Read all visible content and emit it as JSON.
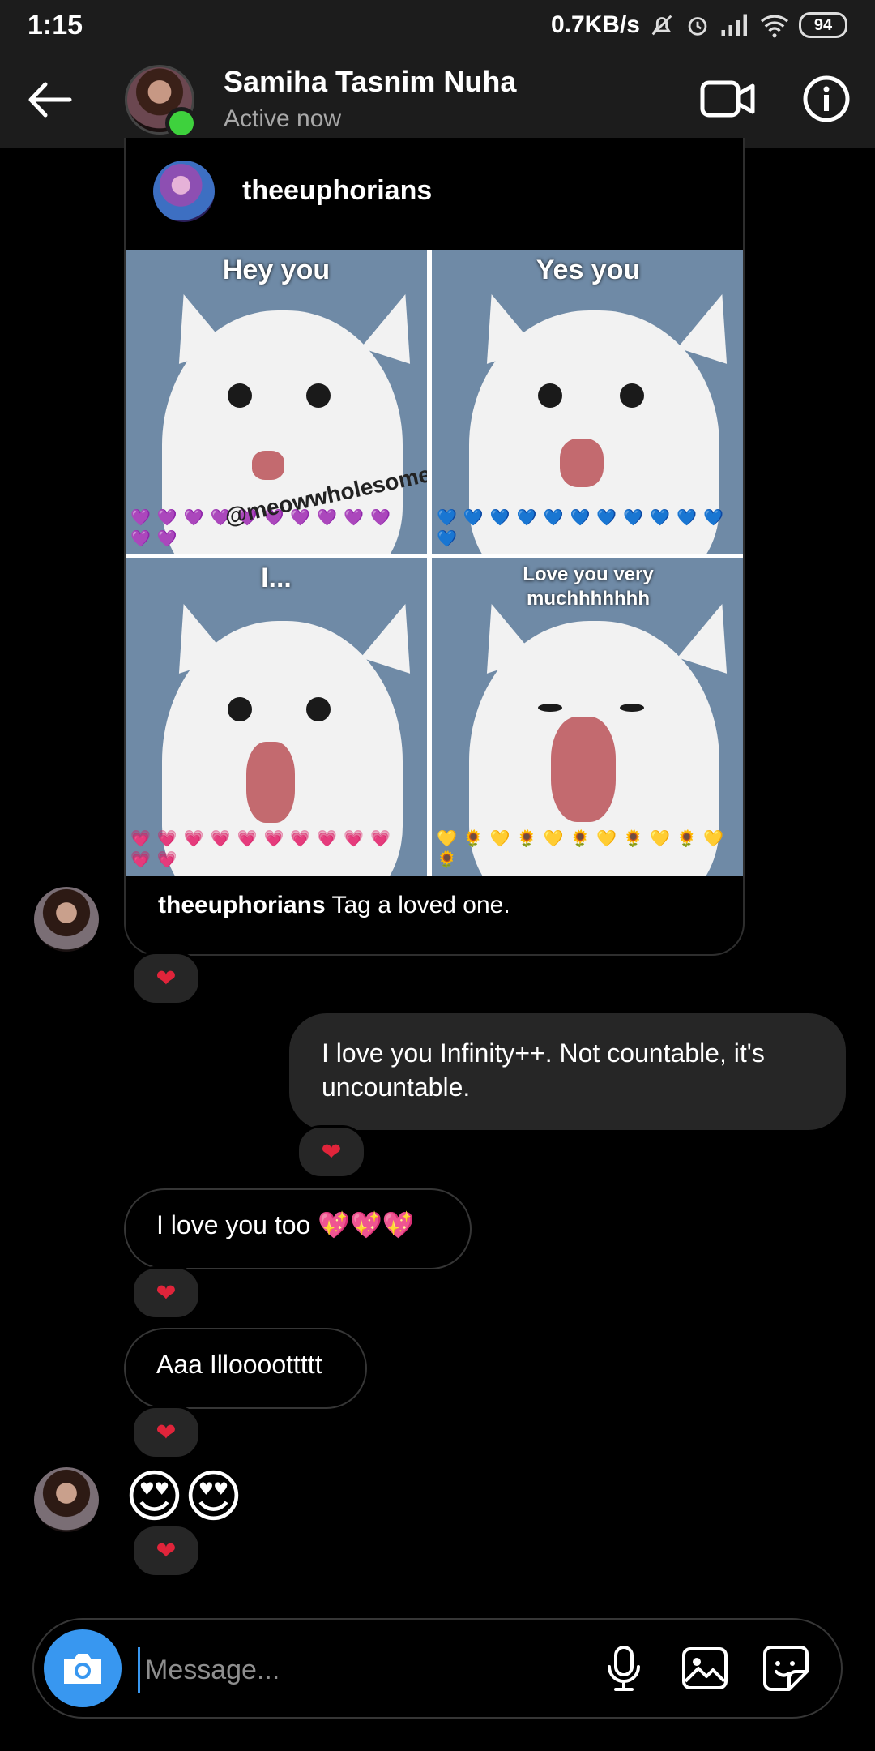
{
  "status_bar": {
    "time": "1:15",
    "network_speed": "0.7KB/s",
    "battery": "94",
    "icons": [
      "mute-bell-icon",
      "alarm-icon",
      "signal-icon",
      "wifi-icon",
      "battery-icon"
    ]
  },
  "header": {
    "name": "Samiha Tasnim Nuha",
    "status": "Active now",
    "icons": [
      "back-arrow-icon",
      "video-call-icon",
      "info-icon"
    ]
  },
  "post": {
    "username": "theeuphorians",
    "tiles": [
      {
        "label": "Hey you",
        "hearts": "💜💜💜💜💜💜💜💜💜💜💜💜"
      },
      {
        "label": "Yes you",
        "hearts": "💙💙💙💙💙💙💙💙💙💙💙💙"
      },
      {
        "label": "I...",
        "hearts": "💗💗💗💗💗💗💗💗💗💗💗💗"
      },
      {
        "label": "Love you very muchhhhhhh",
        "hearts": "💛🌻💛🌻💛🌻💛🌻💛🌻💛🌻"
      }
    ],
    "watermark": "@meowwholesomes",
    "caption_user": "theeuphorians",
    "caption_text": " Tag a loved one."
  },
  "messages": [
    {
      "text": "I love you Infinity++. Not countable, it's uncountable.",
      "reaction": "❤"
    },
    {
      "text": "I love you too 💖💖💖",
      "reaction": "❤"
    },
    {
      "text": "Aaa Illoooottttt",
      "reaction": "❤"
    },
    {
      "text": "😍😍",
      "reaction": "❤"
    }
  ],
  "post_reaction": "❤",
  "composer": {
    "placeholder": "Message...",
    "icons": [
      "camera-icon",
      "microphone-icon",
      "gallery-icon",
      "sticker-icon"
    ]
  },
  "colors": {
    "background": "#000000",
    "bar": "#1c1c1c",
    "bubble_out": "#262626",
    "accent": "#3897f0",
    "online": "#3ed13d",
    "heart": "#e0243a"
  }
}
